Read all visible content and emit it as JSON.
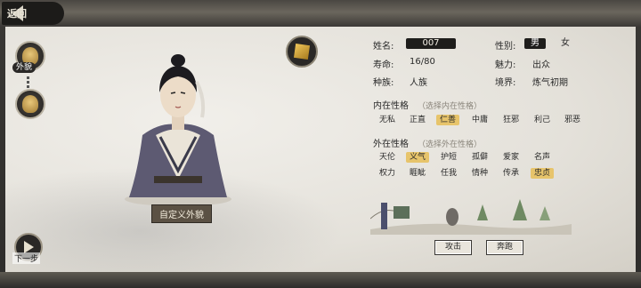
{
  "nav": {
    "back_label": "返回",
    "next_label": "下一步"
  },
  "sidebar": {
    "appearance_label": "外貌"
  },
  "character": {
    "custom_appearance_label": "自定义外貌"
  },
  "profile": {
    "name_label": "姓名:",
    "name_value": "007",
    "gender_label": "性别:",
    "gender_options": [
      "男",
      "女"
    ],
    "gender_selected": "男",
    "lifespan_label": "寿命:",
    "lifespan_value": "16/80",
    "charm_label": "魅力:",
    "charm_value": "出众",
    "race_label": "种族:",
    "race_value": "人族",
    "realm_label": "境界:",
    "realm_value": "炼气初期"
  },
  "inner": {
    "title": "内在性格",
    "hint": "（选择内在性格）",
    "traits": [
      "无私",
      "正直",
      "仁善",
      "中庸",
      "狂邪",
      "利己",
      "邪恶"
    ],
    "selected": "仁善"
  },
  "outer": {
    "title": "外在性格",
    "hint": "（选择外在性格）",
    "row1": [
      "天伦",
      "义气",
      "护短",
      "孤僻",
      "爱家",
      "名声"
    ],
    "row2": [
      "权力",
      "睚眦",
      "任我",
      "情种",
      "传承",
      "忠贞"
    ],
    "selected": [
      "义气",
      "忠贞"
    ]
  },
  "actions": {
    "attack_label": "攻击",
    "flee_label": "奔跑"
  },
  "colors": {
    "selected_trait": "#e7c46b",
    "dark_chip": "#1e1d1b"
  }
}
